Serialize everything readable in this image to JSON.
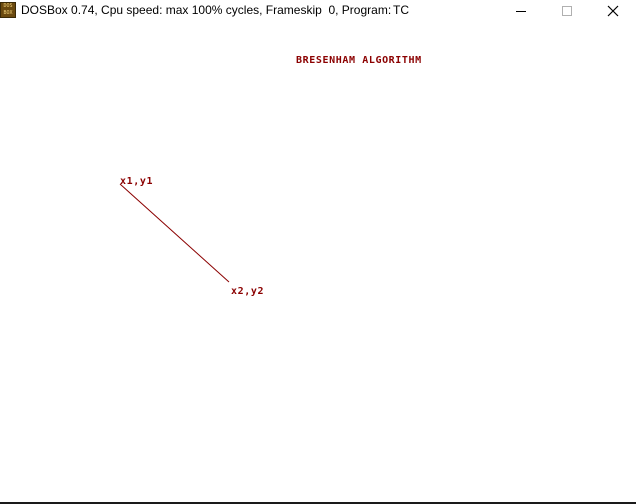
{
  "window": {
    "title": "DOSBox 0.74, Cpu speed: max 100% cycles, Frameskip  0, Program:",
    "program": "TC",
    "icon_text": "DOS BOX",
    "controls": {
      "minimize": "minimize-icon",
      "maximize": "maximize-icon",
      "close": "close-icon"
    }
  },
  "screen": {
    "heading": "BRESENHAM ALGORITHM",
    "start_label": "x1,y1",
    "end_label": "x2,y2",
    "line_color": "#8b0000",
    "text_color": "#8b0000",
    "background": "#ffffff"
  }
}
